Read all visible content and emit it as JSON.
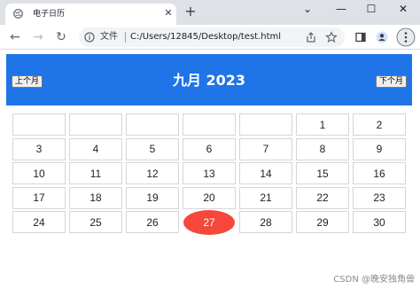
{
  "browser": {
    "tab_title": "电子日历",
    "tab_close": "✕",
    "new_tab": "+",
    "window_controls": {
      "dropdown": "⌄",
      "minimize": "—",
      "maximize": "☐",
      "close": "✕"
    },
    "nav": {
      "back": "←",
      "forward": "→",
      "reload": "↻"
    },
    "omnibox": {
      "label": "文件",
      "url": "C:/Users/12845/Desktop/test.html"
    },
    "icons": [
      "info-icon",
      "share-icon",
      "star-icon",
      "side-panel-icon",
      "profile-icon",
      "more-menu-icon"
    ]
  },
  "calendar": {
    "title": "九月 2023",
    "prev_label": "上个月",
    "next_label": "下个月",
    "today": "27",
    "weeks": [
      [
        "",
        "",
        "",
        "",
        "",
        "1",
        "2"
      ],
      [
        "3",
        "4",
        "5",
        "6",
        "7",
        "8",
        "9"
      ],
      [
        "10",
        "11",
        "12",
        "13",
        "14",
        "15",
        "16"
      ],
      [
        "17",
        "18",
        "19",
        "20",
        "21",
        "22",
        "23"
      ],
      [
        "24",
        "25",
        "26",
        "27",
        "28",
        "29",
        "30"
      ]
    ],
    "colors": {
      "header": "#1f74e8",
      "today": "#f5473c"
    }
  },
  "watermark": "CSDN @晚安独角兽"
}
